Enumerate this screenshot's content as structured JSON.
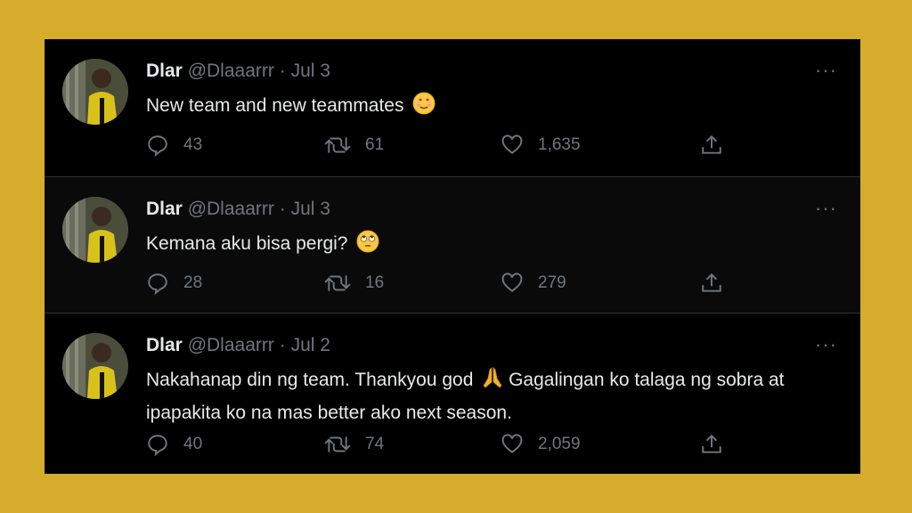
{
  "tweets": [
    {
      "name": "Dlar",
      "handle": "@Dlaaarrr",
      "date": "Jul 3",
      "text": "New team and new teammates",
      "emoji": "smiling-face-with-heart-eyes",
      "replies": "43",
      "retweets": "61",
      "likes": "1,635"
    },
    {
      "name": "Dlar",
      "handle": "@Dlaaarrr",
      "date": "Jul 3",
      "text": "Kemana aku bisa pergi?",
      "emoji": "face-with-rolling-eyes",
      "replies": "28",
      "retweets": "16",
      "likes": "279"
    },
    {
      "name": "Dlar",
      "handle": "@Dlaaarrr",
      "date": "Jul 2",
      "text_before": "Nakahanap din ng team. Thankyou god",
      "text_after": "Gagalingan ko talaga ng sobra at ipapakita ko na mas better ako next season.",
      "emoji": "folded-hands",
      "replies": "40",
      "retweets": "74",
      "likes": "2,059"
    }
  ],
  "separator": "·",
  "more_label": "···",
  "colors": {
    "background": "#d5ac2c",
    "panel": "#000000",
    "text": "#e7e9ea",
    "muted": "#71767b",
    "divider": "#2f3336"
  }
}
